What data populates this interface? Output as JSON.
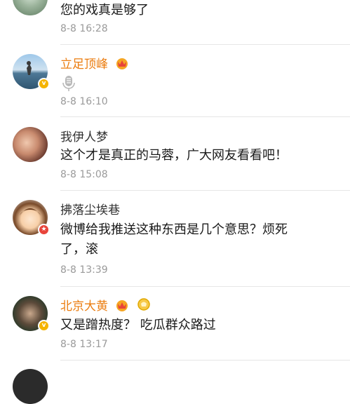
{
  "comments": [
    {
      "text": "您的戏真是够了",
      "time": "8-8 16:28"
    },
    {
      "name": "立足顶峰",
      "voice_icon": "microphone-icon",
      "time": "8-8 16:10",
      "badge": "verified-gold"
    },
    {
      "name": "我伊人梦",
      "text": "这个才是真正的马蓉，广大网友看看吧！",
      "time": "8-8 15:08"
    },
    {
      "name": "拂落尘埃巷",
      "text_line1": "微博给我推送这种东西是几个意思？烦死",
      "text_line2": "了，滚",
      "time": "8-8 13:39",
      "badge": "verified-red"
    },
    {
      "name": "北京大黄",
      "text": "又是蹭热度？ 吃瓜群众路过",
      "time": "8-8 13:17",
      "badge": "verified-gold"
    }
  ],
  "colors": {
    "vip_name": "#eb7d10",
    "text": "#1a1a1a",
    "time": "#9a9a9a",
    "gold": "#f5b400",
    "red": "#e8443a"
  }
}
